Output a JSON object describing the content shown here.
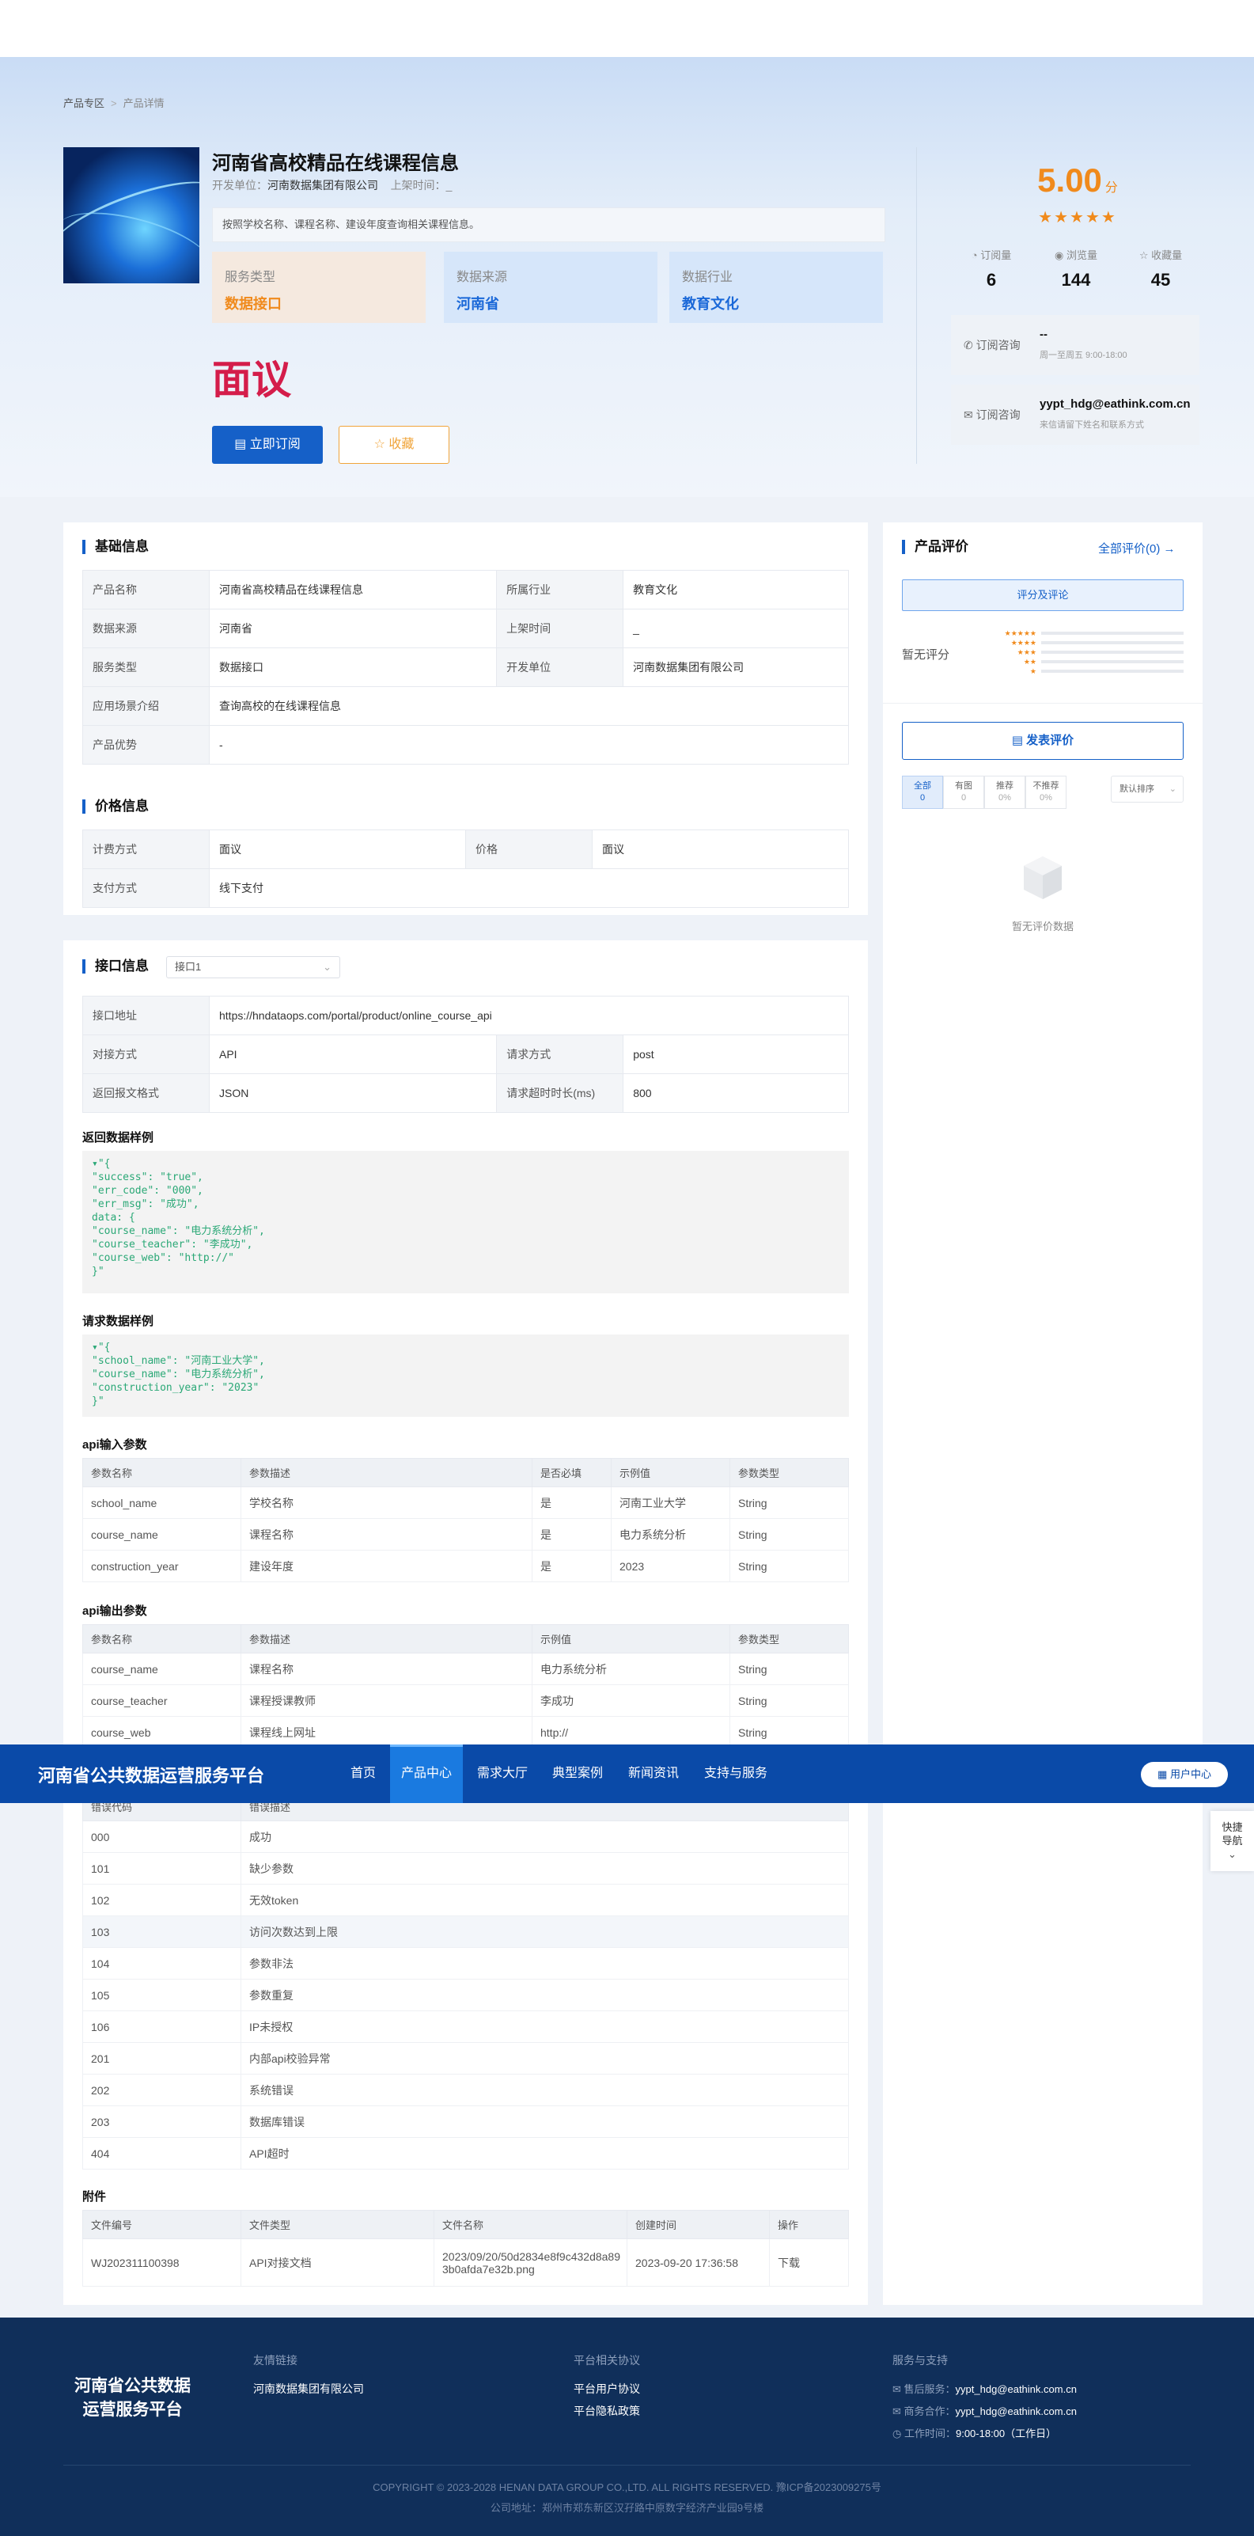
{
  "breadcrumb": {
    "home": "产品专区",
    "sep": ">",
    "current": "产品详情"
  },
  "product": {
    "title": "河南省高校精品在线课程信息",
    "developer_label": "开发单位：",
    "developer": "河南数据集团有限公司",
    "listed_label": "上架时间：",
    "listed": "_",
    "description": "按照学校名称、课程名称、建设年度查询相关课程信息。",
    "price": "面议",
    "subscribe": "立即订阅",
    "favorite": "收藏"
  },
  "tags": [
    {
      "label": "服务类型",
      "value": "数据接口"
    },
    {
      "label": "数据来源",
      "value": "河南省"
    },
    {
      "label": "数据行业",
      "value": "教育文化"
    }
  ],
  "rating": {
    "score": "5.00",
    "unit": "分",
    "stars": "★★★★★"
  },
  "stats": [
    {
      "label": "订阅量",
      "value": "6",
      "icon": "subscribe-icon"
    },
    {
      "label": "浏览量",
      "value": "144",
      "icon": "eye-icon"
    },
    {
      "label": "收藏量",
      "value": "45",
      "icon": "star-icon"
    }
  ],
  "consult": {
    "label": "订阅咨询",
    "phone": "--",
    "hours": "周一至周五 9:00-18:00",
    "email": "yypt_hdg@eathink.com.cn",
    "email_note": "来信请留下姓名和联系方式"
  },
  "basic": {
    "title": "基础信息",
    "rows": [
      [
        "产品名称",
        "河南省高校精品在线课程信息",
        "所属行业",
        "教育文化"
      ],
      [
        "数据来源",
        "河南省",
        "上架时间",
        "_"
      ],
      [
        "服务类型",
        "数据接口",
        "开发单位",
        "河南数据集团有限公司"
      ]
    ],
    "scene_label": "应用场景介绍",
    "scene": "查询高校的在线课程信息",
    "adv_label": "产品优势",
    "adv": "-"
  },
  "pricing": {
    "title": "价格信息",
    "rows": [
      [
        "计费方式",
        "面议",
        "价格",
        "面议"
      ]
    ],
    "pay_label": "支付方式",
    "pay": "线下支付"
  },
  "api": {
    "title": "接口信息",
    "select": "接口1",
    "url_label": "接口地址",
    "url": "https://hndataops.com/portal/product/online_course_api",
    "rows": [
      [
        "对接方式",
        "API",
        "请求方式",
        "post"
      ],
      [
        "返回报文格式",
        "JSON",
        "请求超时时长(ms)",
        "800"
      ]
    ],
    "resp_title": "返回数据样例",
    "resp_code": "▾\"{\n\"success\": \"true\",\n\"err_code\": \"000\",\n\"err_msg\": \"成功\",\ndata: {\n\"course_name\": \"电力系统分析\",\n\"course_teacher\": \"李成功\",\n\"course_web\": \"http://\"\n}\"",
    "req_title": "请求数据样例",
    "req_code": "▾\"{\n\"school_name\": \"河南工业大学\",\n\"course_name\": \"电力系统分析\",\n\"construction_year\": \"2023\"\n}\"",
    "in_title": "api输入参数",
    "in_headers": [
      "参数名称",
      "参数描述",
      "是否必填",
      "示例值",
      "参数类型"
    ],
    "in_rows": [
      [
        "school_name",
        "学校名称",
        "是",
        "河南工业大学",
        "String"
      ],
      [
        "course_name",
        "课程名称",
        "是",
        "电力系统分析",
        "String"
      ],
      [
        "construction_year",
        "建设年度",
        "是",
        "2023",
        "String"
      ]
    ],
    "out_title": "api输出参数",
    "out_headers": [
      "参数名称",
      "参数描述",
      "示例值",
      "参数类型"
    ],
    "out_rows": [
      [
        "course_name",
        "课程名称",
        "电力系统分析",
        "String"
      ],
      [
        "course_teacher",
        "课程授课教师",
        "李成功",
        "String"
      ],
      [
        "course_web",
        "课程线上网址",
        "http://",
        "String"
      ]
    ],
    "err_headers": [
      "错误代码",
      "错误描述"
    ],
    "err_rows": [
      [
        "000",
        "成功"
      ],
      [
        "101",
        "缺少参数"
      ],
      [
        "102",
        "无效token"
      ],
      [
        "103",
        "访问次数达到上限"
      ],
      [
        "104",
        "参数非法"
      ],
      [
        "105",
        "参数重复"
      ],
      [
        "106",
        "IP未授权"
      ],
      [
        "201",
        "内部api校验异常"
      ],
      [
        "202",
        "系统错误"
      ],
      [
        "203",
        "数据库错误"
      ],
      [
        "404",
        "API超时"
      ]
    ]
  },
  "attach": {
    "title": "附件",
    "headers": [
      "文件编号",
      "文件类型",
      "文件名称",
      "创建时间",
      "操作"
    ],
    "row": [
      "WJ202311100398",
      "API对接文档",
      "2023/09/20/50d2834e8f9c432d8a893b0afda7e32b.png",
      "2023-09-20 17:36:58",
      "下载"
    ]
  },
  "review": {
    "title": "产品评价",
    "all": "全部评价(0)",
    "arrow": "→",
    "tab": "评分及评论",
    "none": "暂无评分",
    "post": "发表评价",
    "filters": [
      {
        "l": "全部",
        "v": "0"
      },
      {
        "l": "有图",
        "v": "0"
      },
      {
        "l": "推荐",
        "v": "0%"
      },
      {
        "l": "不推荐",
        "v": "0%"
      }
    ],
    "sort": "默认排序",
    "empty": "暂无评价数据"
  },
  "nav": {
    "brand": "河南省公共数据运营服务平台",
    "items": [
      "首页",
      "产品中心",
      "需求大厅",
      "典型案例",
      "新闻资讯",
      "支持与服务"
    ],
    "user": "用户中心"
  },
  "float": {
    "label": "快捷导航"
  },
  "footer": {
    "brand_line1": "河南省公共数据",
    "brand_line2": "运营服务平台",
    "links_h": "友情链接",
    "link1": "河南数据集团有限公司",
    "proto_h": "平台相关协议",
    "proto1": "平台用户协议",
    "proto2": "平台隐私政策",
    "svc_h": "服务与支持",
    "svc1_l": "售后服务：",
    "svc1": "yypt_hdg@eathink.com.cn",
    "svc2_l": "商务合作：",
    "svc2": "yypt_hdg@eathink.com.cn",
    "svc3_l": "工作时间：",
    "svc3": "9:00-18:00（工作日）",
    "copyright": "COPYRIGHT © 2023-2028 HENAN DATA GROUP CO.,LTD. ALL RIGHTS RESERVED. 豫ICP备2023009275号",
    "address": "公司地址：郑州市郑东新区汉孖路中原数字经济产业园9号楼"
  }
}
